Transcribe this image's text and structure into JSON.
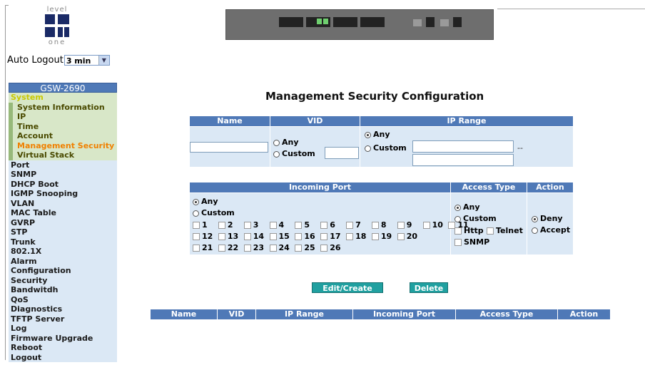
{
  "logo": {
    "top_text": "level",
    "bottom_text": "one"
  },
  "auto_logout": {
    "label": "Auto Logout",
    "value": "3 min"
  },
  "sidebar": {
    "title": "GSW-2690",
    "items": [
      {
        "label": "System",
        "kind": "group"
      },
      {
        "label": "System Information",
        "kind": "sub"
      },
      {
        "label": "IP",
        "kind": "sub"
      },
      {
        "label": "Time",
        "kind": "sub"
      },
      {
        "label": "Account",
        "kind": "sub"
      },
      {
        "label": "Management Security",
        "kind": "sub-active"
      },
      {
        "label": "Virtual Stack",
        "kind": "sub"
      },
      {
        "label": "Port",
        "kind": "item"
      },
      {
        "label": "SNMP",
        "kind": "item"
      },
      {
        "label": "DHCP Boot",
        "kind": "item"
      },
      {
        "label": "IGMP Snooping",
        "kind": "item"
      },
      {
        "label": "VLAN",
        "kind": "item"
      },
      {
        "label": "MAC Table",
        "kind": "item"
      },
      {
        "label": "GVRP",
        "kind": "item"
      },
      {
        "label": "STP",
        "kind": "item"
      },
      {
        "label": "Trunk",
        "kind": "item"
      },
      {
        "label": "802.1X",
        "kind": "item"
      },
      {
        "label": "Alarm",
        "kind": "item"
      },
      {
        "label": "Configuration",
        "kind": "item"
      },
      {
        "label": "Security",
        "kind": "item"
      },
      {
        "label": "Bandwitdh",
        "kind": "item"
      },
      {
        "label": "QoS",
        "kind": "item"
      },
      {
        "label": "Diagnostics",
        "kind": "item"
      },
      {
        "label": "TFTP Server",
        "kind": "item"
      },
      {
        "label": "Log",
        "kind": "item"
      },
      {
        "label": "Firmware Upgrade",
        "kind": "item"
      },
      {
        "label": "Reboot",
        "kind": "item"
      },
      {
        "label": "Logout",
        "kind": "item"
      }
    ]
  },
  "page_title": "Management Security Configuration",
  "table1": {
    "headers": {
      "name": "Name",
      "vid": "VID",
      "ip_range": "IP Range"
    },
    "vid": {
      "any": "Any",
      "custom": "Custom"
    },
    "ip": {
      "any": "Any",
      "custom": "Custom",
      "separator": "--"
    }
  },
  "table2": {
    "headers": {
      "incoming_port": "Incoming Port",
      "access_type": "Access Type",
      "action": "Action"
    },
    "ports": {
      "any": "Any",
      "custom": "Custom",
      "row1": [
        "1",
        "2",
        "3",
        "4",
        "5",
        "6",
        "7",
        "8",
        "9",
        "10",
        "11"
      ],
      "row2": [
        "12",
        "13",
        "14",
        "15",
        "16",
        "17",
        "18",
        "19",
        "20"
      ],
      "row3": [
        "21",
        "22",
        "23",
        "24",
        "25",
        "26"
      ]
    },
    "access": {
      "any": "Any",
      "custom": "Custom",
      "http": "Http",
      "telnet": "Telnet",
      "snmp": "SNMP"
    },
    "action": {
      "deny": "Deny",
      "accept": "Accept"
    }
  },
  "buttons": {
    "edit_create": "Edit/Create",
    "delete": "Delete"
  },
  "list_headers": [
    "Name",
    "VID",
    "IP Range",
    "Incoming Port",
    "Access Type",
    "Action"
  ]
}
